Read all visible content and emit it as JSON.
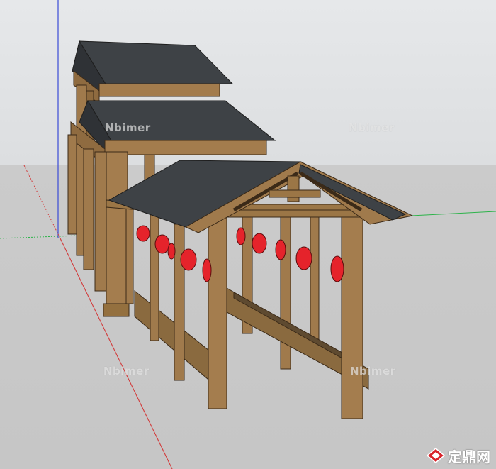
{
  "canvas": {
    "sky_color": "#e3e5e7",
    "ground_color": "#c6c6c6",
    "axis_colors": {
      "red": "#d23b3b",
      "green": "#2db34a",
      "blue": "#3a4bd6"
    }
  },
  "model": {
    "roof_color": "#3e4246",
    "wood_color": "#a07a4c",
    "lantern_color": "#e5232b"
  },
  "watermarks": [
    "Nbimer",
    "Nbimer",
    "Nbimer",
    "Nbimer"
  ],
  "logo": {
    "text": "定鼎网",
    "icon": "diamond-logo-icon"
  }
}
